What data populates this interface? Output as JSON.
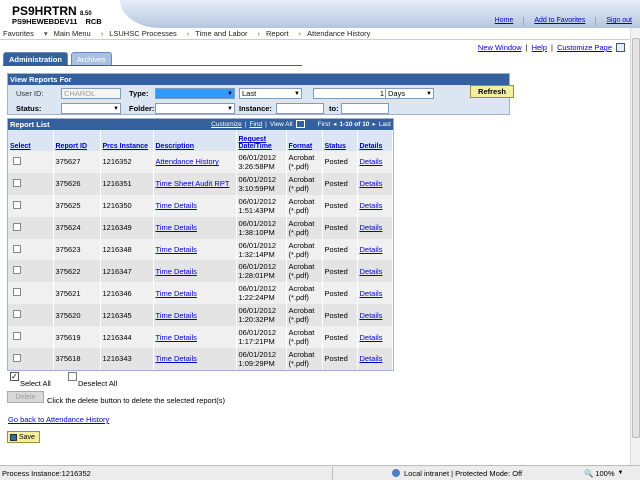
{
  "header": {
    "app_name": "PS9HRTRN",
    "version": "8.50",
    "server": "PS9HEWEBDEV11",
    "user": "RCB",
    "links": [
      "Home",
      "Add to Favorites",
      "Sign out"
    ]
  },
  "menubar": {
    "items": [
      "Favorites",
      "Main Menu",
      "LSUHSC Processes",
      "Time and Labor",
      "Report",
      "Attendance History"
    ]
  },
  "pagelinks": [
    "New Window",
    "Help",
    "Customize Page"
  ],
  "tabs": [
    "Administration",
    "Archives"
  ],
  "view_reports": {
    "title": "View Reports For",
    "user_id_label": "User ID:",
    "user_id_value": "CHAROL",
    "type_label": "Type:",
    "type_value": "",
    "last_value": "Last",
    "count_value": "1",
    "unit_value": "Days",
    "refresh_label": "Refresh",
    "status_label": "Status:",
    "folder_label": "Folder:",
    "instance_label": "Instance:",
    "to_label": "to:"
  },
  "report_list": {
    "title": "Report List",
    "nav": {
      "customize": "Customize",
      "find": "Find",
      "view_all": "View All",
      "first": "First",
      "range": "1-10 of 10",
      "last": "Last"
    },
    "columns": [
      "Select",
      "Report ID",
      "Prcs Instance",
      "Description",
      "Request Date/Time",
      "Format",
      "Status",
      "Details"
    ],
    "rows": [
      {
        "report_id": "375627",
        "instance": "1216352",
        "description": "Attendance History",
        "date": "06/01/2012",
        "time": "3:26:58PM",
        "format1": "Acrobat",
        "format2": "(*.pdf)",
        "status": "Posted",
        "details": "Details"
      },
      {
        "report_id": "375626",
        "instance": "1216351",
        "description": "Time Sheet Audit RPT",
        "date": "06/01/2012",
        "time": "3:10:59PM",
        "format1": "Acrobat",
        "format2": "(*.pdf)",
        "status": "Posted",
        "details": "Details"
      },
      {
        "report_id": "375625",
        "instance": "1216350",
        "description": "Time Details",
        "date": "06/01/2012",
        "time": "1:51:43PM",
        "format1": "Acrobat",
        "format2": "(*.pdf)",
        "status": "Posted",
        "details": "Details"
      },
      {
        "report_id": "375624",
        "instance": "1216349",
        "description": "Time Details",
        "date": "06/01/2012",
        "time": "1:38:10PM",
        "format1": "Acrobat",
        "format2": "(*.pdf)",
        "status": "Posted",
        "details": "Details"
      },
      {
        "report_id": "375623",
        "instance": "1216348",
        "description": "Time Details",
        "date": "06/01/2012",
        "time": "1:32:14PM",
        "format1": "Acrobat",
        "format2": "(*.pdf)",
        "status": "Posted",
        "details": "Details"
      },
      {
        "report_id": "375622",
        "instance": "1216347",
        "description": "Time Details",
        "date": "06/01/2012",
        "time": "1:28:01PM",
        "format1": "Acrobat",
        "format2": "(*.pdf)",
        "status": "Posted",
        "details": "Details"
      },
      {
        "report_id": "375621",
        "instance": "1216346",
        "description": "Time Details",
        "date": "06/01/2012",
        "time": "1:22:24PM",
        "format1": "Acrobat",
        "format2": "(*.pdf)",
        "status": "Posted",
        "details": "Details"
      },
      {
        "report_id": "375620",
        "instance": "1216345",
        "description": "Time Details",
        "date": "06/01/2012",
        "time": "1:20:32PM",
        "format1": "Acrobat",
        "format2": "(*.pdf)",
        "status": "Posted",
        "details": "Details"
      },
      {
        "report_id": "375619",
        "instance": "1216344",
        "description": "Time Details",
        "date": "06/01/2012",
        "time": "1:17:21PM",
        "format1": "Acrobat",
        "format2": "(*.pdf)",
        "status": "Posted",
        "details": "Details"
      },
      {
        "report_id": "375618",
        "instance": "1216343",
        "description": "Time Details",
        "date": "06/01/2012",
        "time": "1:09:29PM",
        "format1": "Acrobat",
        "format2": "(*.pdf)",
        "status": "Posted",
        "details": "Details"
      }
    ]
  },
  "actions": {
    "select_all": "Select All",
    "deselect_all": "Deselect All",
    "delete_label": "Delete",
    "delete_hint": "Click the delete button to delete the selected report(s)",
    "go_back": "Go back to Attendance History",
    "save_label": "Save"
  },
  "statusbar": {
    "left": "Process Instance:1216352",
    "zone": "Local intranet | Protected Mode: Off",
    "zoom": "100%"
  }
}
